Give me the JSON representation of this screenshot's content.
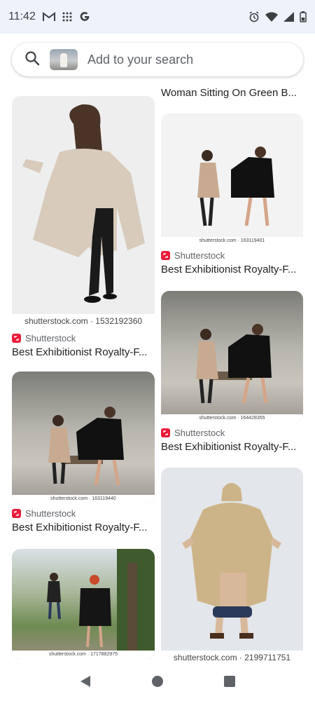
{
  "status_bar": {
    "time": "11:42",
    "left_icons": [
      "gmail-icon",
      "grid-icon",
      "google-icon"
    ],
    "right_icons": [
      "alarm-icon",
      "wifi-icon",
      "signal-icon",
      "battery-icon"
    ]
  },
  "search": {
    "placeholder": "Add to your search"
  },
  "results": {
    "top_partial_title": "Woman Sitting On Green B...",
    "cards": [
      {
        "source": "Shutterstock",
        "title": "Best Exhibitionist Royalty-F...",
        "watermark": "shutterstock.com · 1532192360"
      },
      {
        "source": "Shutterstock",
        "title": "Best Exhibitionist Royalty-F...",
        "watermark": "shutterstock.com · 163119401"
      },
      {
        "source": "Shutterstock",
        "title": "Best Exhibitionist Royalty-F...",
        "watermark": "shutterstock.com · 164428355"
      },
      {
        "source": "Shutterstock",
        "title": "Best Exhibitionist Royalty-F...",
        "watermark": "shutterstock.com · 163119440"
      },
      {
        "watermark": "shutterstock.com · 1717882975"
      },
      {
        "watermark": "shutterstock.com · 2199711751"
      }
    ]
  },
  "nav": {
    "icons": [
      "back-icon",
      "home-icon",
      "recents-icon"
    ]
  },
  "colors": {
    "status_bg": "#eef2fa",
    "source_badge": "#ea1d3a"
  }
}
